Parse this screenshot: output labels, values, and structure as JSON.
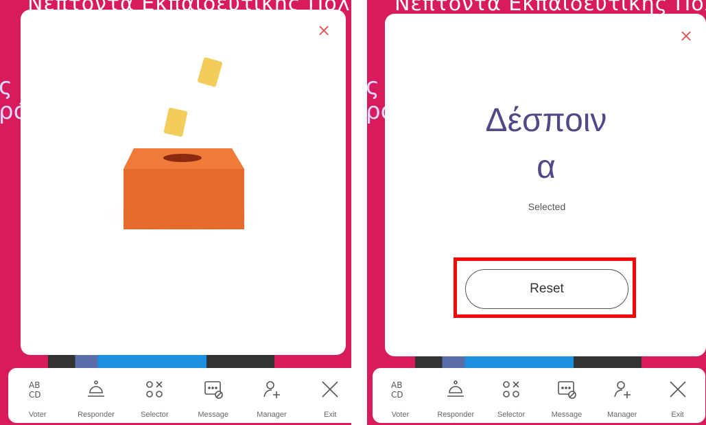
{
  "background": {
    "header_text": "Νεπτοντα Εκπαιδευτικής Πολιτικής",
    "side_text_left": "ς\nρό",
    "side_text_right": "ς\nρό"
  },
  "left_panel": {
    "close_label": "×"
  },
  "right_panel": {
    "close_label": "×",
    "selected_name_line1": "Δέσποιν",
    "selected_name_line2": "α",
    "selected_label": "Selected",
    "reset_label": "Reset"
  },
  "toolbar": {
    "items": [
      {
        "label": "Voter",
        "icon": "abcd-voter-icon"
      },
      {
        "label": "Responder",
        "icon": "bell-responder-icon"
      },
      {
        "label": "Selector",
        "icon": "selector-icon"
      },
      {
        "label": "Message",
        "icon": "message-icon"
      },
      {
        "label": "Manager",
        "icon": "add-user-icon"
      },
      {
        "label": "Exit",
        "icon": "close-icon"
      }
    ]
  },
  "colors": {
    "background": "#d71b5c",
    "box": "#e66a2c",
    "ballot": "#f2cd5c",
    "name_text": "#4f4a86",
    "close": "#e05a5a",
    "highlight": "#ff0000"
  }
}
